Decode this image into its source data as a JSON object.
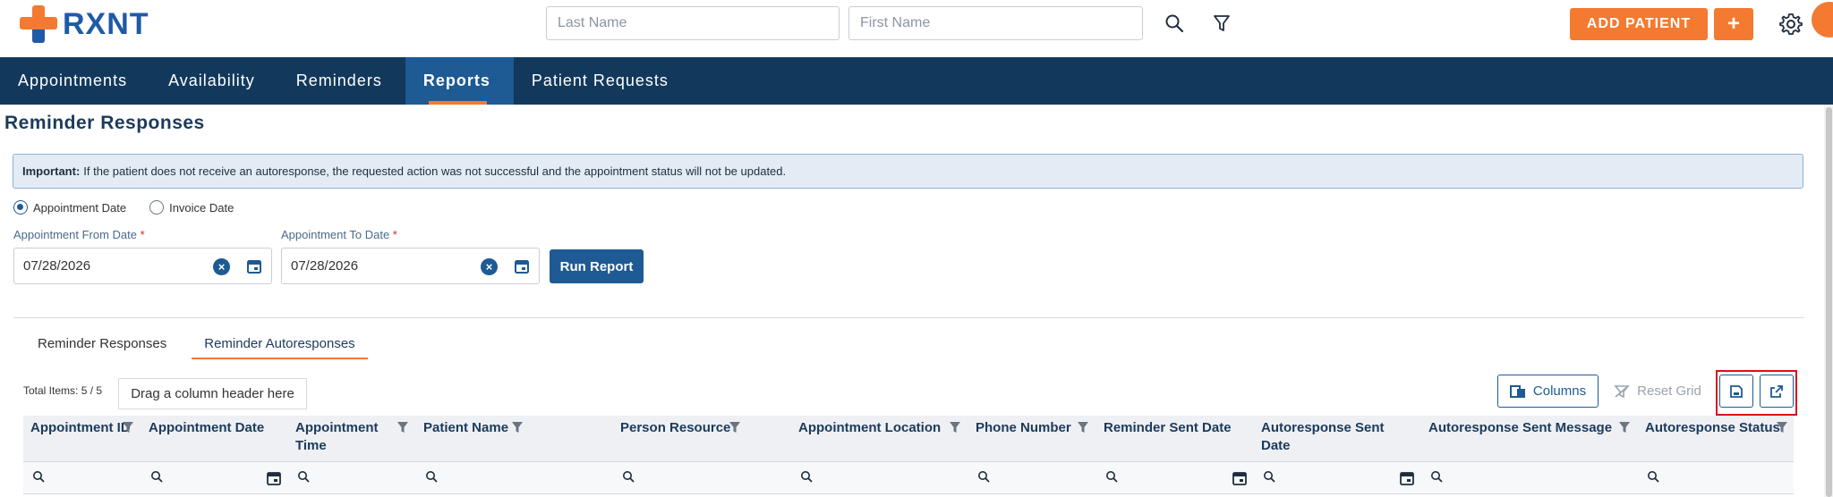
{
  "brand": {
    "name": "RXNT",
    "accent": "#f47a31",
    "primary": "#1e5a93",
    "nav_bg": "#12395c"
  },
  "header": {
    "last_name_placeholder": "Last Name",
    "first_name_placeholder": "First Name",
    "search_icon": "search-icon",
    "filter_icon": "filter-icon",
    "add_patient_label": "ADD PATIENT",
    "add_plus_label": "+",
    "settings_icon": "gear-icon"
  },
  "nav": {
    "items": [
      {
        "label": "Appointments",
        "active": false
      },
      {
        "label": "Availability",
        "active": false
      },
      {
        "label": "Reminders",
        "active": false
      },
      {
        "label": "Reports",
        "active": true
      },
      {
        "label": "Patient Requests",
        "active": false
      }
    ]
  },
  "page": {
    "title": "Reminder Responses",
    "notice_bold": "Important:",
    "notice_text": "If the patient does not receive an autoresponse, the requested action was not successful and the appointment status will not be updated.",
    "radio_options": [
      {
        "label": "Appointment Date",
        "checked": true
      },
      {
        "label": "Invoice Date",
        "checked": false
      }
    ],
    "from_label": "Appointment From Date",
    "to_label": "Appointment To Date",
    "required_mark": "*",
    "from_value": "07/28/2026",
    "to_value": "07/28/2026",
    "run_report_label": "Run Report",
    "tabs": [
      {
        "label": "Reminder Responses",
        "active": false
      },
      {
        "label": "Reminder Autoresponses",
        "active": true
      }
    ]
  },
  "grid": {
    "total_items": "Total Items: 5 / 5",
    "drag_hint": "Drag a column header here",
    "columns_button": "Columns",
    "reset_grid_button": "Reset Grid",
    "columns": [
      {
        "title": "Appointment ID",
        "date_filter": false
      },
      {
        "title": "Appointment Date",
        "date_filter": true
      },
      {
        "title": "Appointment Time",
        "date_filter": false
      },
      {
        "title": "Patient Name",
        "date_filter": false
      },
      {
        "title": "Person Resource",
        "date_filter": false
      },
      {
        "title": "Appointment Location",
        "date_filter": false
      },
      {
        "title": "Phone Number",
        "date_filter": false
      },
      {
        "title": "Reminder Sent Date",
        "date_filter": true
      },
      {
        "title": "Autoresponse Sent Date",
        "date_filter": true
      },
      {
        "title": "Autoresponse Sent Message",
        "date_filter": false
      },
      {
        "title": "Autoresponse Status",
        "date_filter": false
      }
    ]
  }
}
